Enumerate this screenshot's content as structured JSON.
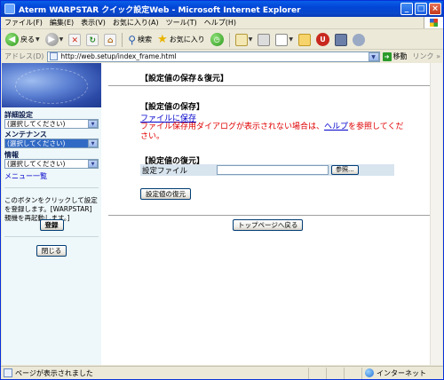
{
  "window": {
    "title": "Aterm WARPSTAR クイック設定Web - Microsoft Internet Explorer",
    "minimize": "_",
    "maximize": "□",
    "close": "×"
  },
  "menu": {
    "items": [
      "ファイル(F)",
      "編集(E)",
      "表示(V)",
      "お気に入り(A)",
      "ツール(T)",
      "ヘルプ(H)"
    ]
  },
  "toolbar": {
    "back_label": "戻る",
    "search_label": "検索",
    "favorites_label": "お気に入り"
  },
  "address": {
    "label": "アドレス(D)",
    "url": "http://web.setup/index_frame.html",
    "go_label": "移動",
    "links_label": "リンク"
  },
  "sidebar": {
    "detail_label": "詳細設定",
    "detail_value": "(選択してください)",
    "maintenance_label": "メンテナンス",
    "maintenance_value": "(選択してください)",
    "info_label": "情報",
    "info_value": "(選択してください)",
    "menu_list_link": "メニュー一覧",
    "note": "このボタンをクリックして設定を登録します。[WARPSTAR]親機を再起動します。]",
    "register_button": "登録",
    "close_button": "閉じる"
  },
  "main": {
    "heading": "【設定値の保存＆復元】",
    "save_section_title": "【設定値の保存】",
    "save_link": "ファイルに保存",
    "warning_before": "ファイル保存用ダイアログが表示されない場合は、",
    "warning_link": "ヘルプ",
    "warning_after": "を参照してください。",
    "restore_section_title": "【設定値の復元】",
    "settings_file_label": "設定ファイル",
    "browse_button": "参照...",
    "restore_button": "設定値の復元",
    "top_page_button": "トップページへ戻る"
  },
  "status": {
    "text": "ページが表示されました",
    "zone": "インターネット"
  },
  "colors": {
    "titlebar": "#0a5fe8",
    "warning_text": "#e00000",
    "link": "#0000cc",
    "left_frame_bg": "#eef7f9",
    "selected_select": "#316ac5"
  }
}
